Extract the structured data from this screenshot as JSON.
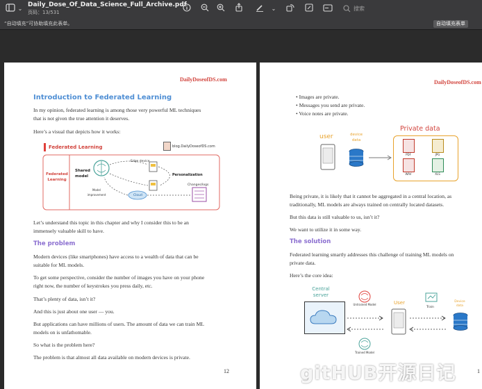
{
  "toolbar": {
    "title": "Daily_Dose_Of_Data_Science_Full_Archive.pdf",
    "subtitle": "页码：13/531",
    "search_placeholder": "搜索"
  },
  "infobar": {
    "message": "“自动填充”可协助填充此表单。",
    "button": "自动填充表单"
  },
  "left_page": {
    "brand": "DailyDoseofDS.com",
    "heading": "Introduction to Federated Learning",
    "para1_l1": "In my opinion, federated learning is among those very powerful ML techniques",
    "para1_l2": "that is not given the true attention it deserves.",
    "para2": "Here’s a visual that depicts how it works:",
    "figure": {
      "title": "Federated Learning",
      "site": "blog.DailyDoseofDS.com",
      "side_label": "Federated Learning",
      "shared_model": "Shared model",
      "edge_device": "Edge device",
      "personalization": "Personalization",
      "changes_logs": "Changes/logs",
      "model_improvement": "Model improvement",
      "cloud": "Cloud"
    },
    "para3_l1": "Let’s understand this topic in this chapter and why I consider this to be an",
    "para3_l2": "immensely valuable skill to have.",
    "problem_heading": "The problem",
    "para4_l1": "Modern devices (like smartphones) have access to a wealth of data that can be",
    "para4_l2": "suitable for ML models.",
    "para5_l1": "To get some perspective, consider the number of images you have on your phone",
    "para5_l2": "right now, the number of keystrokes you press daily, etc.",
    "para6": "That’s plenty of data, isn’t it?",
    "para7": "And this is just about one user — you.",
    "para8_l1": "But applications can have millions of users. The amount of data we can train ML",
    "para8_l2": "models on is unfathomable.",
    "para9": "So what is the problem here?",
    "para10": "The problem is that almost all data available on modern devices is private.",
    "page_number": "12"
  },
  "right_page": {
    "brand": "DailyDoseofDS.com",
    "bullets": [
      "Images are private.",
      "Messages you send are private.",
      "Voice notes are private."
    ],
    "fig1": {
      "user": "user",
      "device_data": "device data",
      "private_data": "Private data",
      "file_labels": [
        "PDF",
        "JPG",
        "WAV",
        "XLS"
      ]
    },
    "para1_l1": "Being private, it is likely that it cannot be aggregated in a central location, as",
    "para1_l2": "traditionally, ML models are always trained on centrally located datasets.",
    "para2": "But this data is still valuable to us, isn’t it?",
    "para3": "We want to utilize it in some way.",
    "solution_heading": "The solution",
    "para4_l1": "Federated learning smartly addresses this challenge of training ML models on",
    "para4_l2": "private data.",
    "para5": "Here’s the core idea:",
    "fig2": {
      "central_server": "Central server",
      "untrained_model": "Untrained Model",
      "user": "User",
      "device_data": "Device data",
      "train": "Train",
      "trained_model": "Trained Model"
    },
    "page_number": "1"
  },
  "watermark": "gitHUB开源日记",
  "colors": {
    "brand_red": "#d2453e",
    "heading_blue": "#4e8ed4",
    "subheading_purple": "#8b6fd0",
    "figure_orange": "#e8a22b"
  }
}
